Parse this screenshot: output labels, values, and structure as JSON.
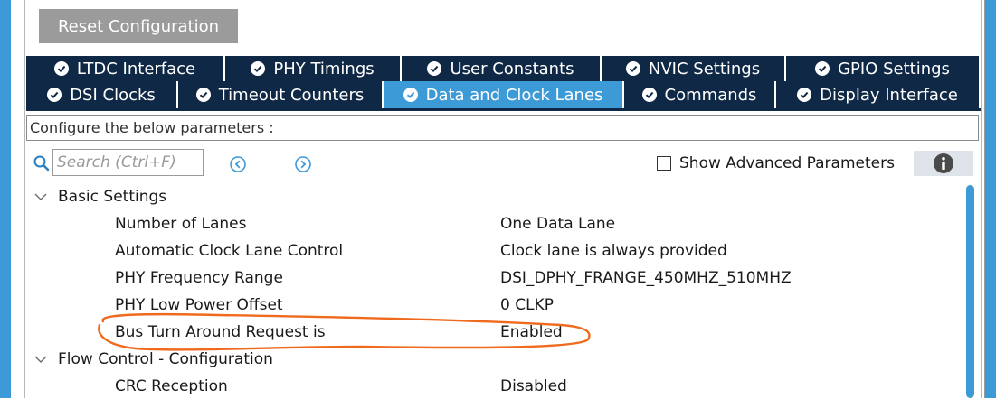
{
  "toolbar": {
    "reset_label": "Reset Configuration"
  },
  "tabs": {
    "row1": [
      {
        "label": "LTDC Interface"
      },
      {
        "label": "PHY Timings"
      },
      {
        "label": "User Constants"
      },
      {
        "label": "NVIC Settings"
      },
      {
        "label": "GPIO Settings"
      }
    ],
    "row2": [
      {
        "label": "DSI Clocks"
      },
      {
        "label": "Timeout Counters"
      },
      {
        "label": "Data and Clock Lanes",
        "active": true
      },
      {
        "label": "Commands"
      },
      {
        "label": "Display Interface"
      }
    ]
  },
  "config": {
    "prompt": "Configure the below parameters :"
  },
  "search": {
    "placeholder": "Search (Ctrl+F)",
    "value": ""
  },
  "advanced": {
    "label": "Show Advanced Parameters",
    "checked": false
  },
  "groups": [
    {
      "title": "Basic Settings",
      "params": [
        {
          "name": "Number of Lanes",
          "value": "One Data Lane"
        },
        {
          "name": "Automatic Clock Lane Control",
          "value": "Clock lane is always provided"
        },
        {
          "name": "PHY Frequency Range",
          "value": "DSI_DPHY_FRANGE_450MHZ_510MHZ"
        },
        {
          "name": "PHY Low Power Offset",
          "value": "0 CLKP"
        },
        {
          "name": "Bus Turn Around Request is",
          "value": "Enabled"
        }
      ]
    },
    {
      "title": "Flow Control - Configuration",
      "params": [
        {
          "name": "CRC Reception",
          "value": "Disabled"
        }
      ]
    }
  ],
  "colors": {
    "accent": "#3c9ad6",
    "tab_dark": "#0f2845",
    "button_gray": "#9b9b9b",
    "annotation": "#f06a1e"
  },
  "icons": {
    "tab_status": "check-circle-icon",
    "search": "search-icon",
    "prev": "circle-arrow-left-icon",
    "next": "circle-arrow-right-icon",
    "info": "info-icon",
    "group_toggle": "chevron-down-icon"
  }
}
